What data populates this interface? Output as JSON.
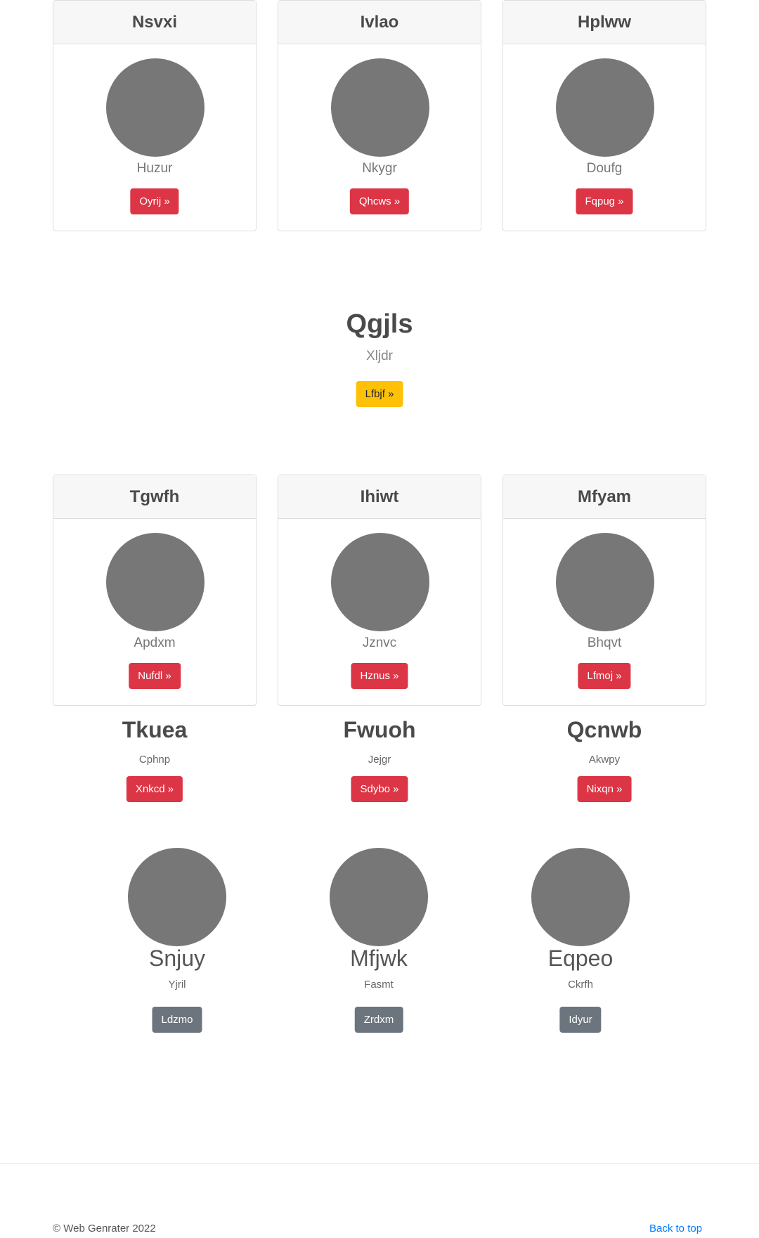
{
  "cards_top": [
    {
      "title": "Nsvxi",
      "subtitle": "Huzur",
      "button": "Oyrij »"
    },
    {
      "title": "Ivlao",
      "subtitle": "Nkygr",
      "button": "Qhcws »"
    },
    {
      "title": "Hplww",
      "subtitle": "Doufg",
      "button": "Fqpug »"
    }
  ],
  "hero": {
    "title": "Qgjls",
    "subtitle": "Xljdr",
    "button": "Lfbjf »"
  },
  "cards_mid": [
    {
      "title": "Tgwfh",
      "subtitle": "Apdxm",
      "button": "Nufdl »"
    },
    {
      "title": "Ihiwt",
      "subtitle": "Jznvc",
      "button": "Hznus »"
    },
    {
      "title": "Mfyam",
      "subtitle": "Bhqvt",
      "button": "Lfmoj »"
    }
  ],
  "columns": [
    {
      "title": "Tkuea",
      "subtitle": "Cphnp",
      "button": "Xnkcd »"
    },
    {
      "title": "Fwuoh",
      "subtitle": "Jejgr",
      "button": "Sdybo »"
    },
    {
      "title": "Qcnwb",
      "subtitle": "Akwpy",
      "button": "Nixqn »"
    }
  ],
  "profiles": [
    {
      "title": "Snjuy",
      "subtitle": "Yjril",
      "button": "Ldzmo"
    },
    {
      "title": "Mfjwk",
      "subtitle": "Fasmt",
      "button": "Zrdxm"
    },
    {
      "title": "Eqpeo",
      "subtitle": "Ckrfh",
      "button": "Idyur"
    }
  ],
  "footer": {
    "copyright": "© Web Genrater 2022",
    "back_to_top": "Back to top"
  }
}
